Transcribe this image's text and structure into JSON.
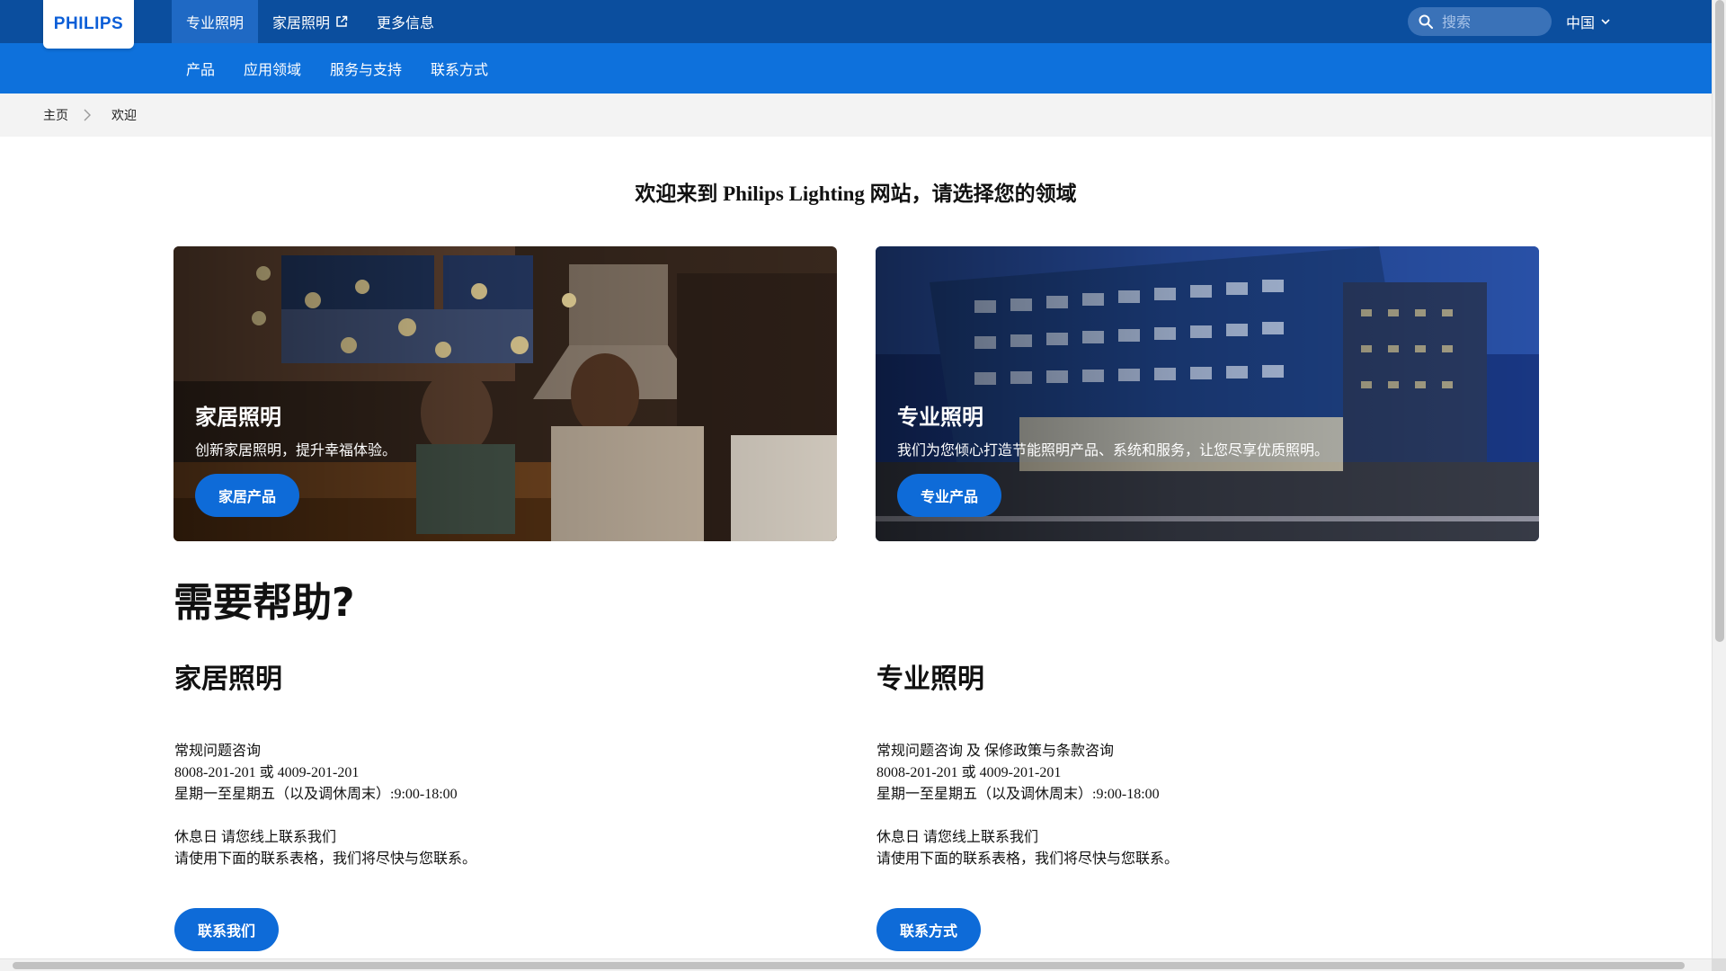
{
  "brand": {
    "logo_text": "PHILIPS",
    "accent": "#0b4e9e",
    "subnav": "#0e71dc",
    "button": "#0e6bd8"
  },
  "topnav": {
    "tabs": [
      {
        "label": "专业照明",
        "active": true
      },
      {
        "label": "家居照明",
        "icon": "external-link-icon"
      },
      {
        "label": "更多信息"
      }
    ],
    "search": {
      "placeholder": "搜索",
      "icon": "search-icon"
    },
    "region": {
      "label": "中国",
      "icon": "chevron-down-icon"
    }
  },
  "subnav": {
    "items": [
      "产品",
      "应用领域",
      "服务与支持",
      "联系方式"
    ]
  },
  "breadcrumb": {
    "items": [
      "主页",
      "欢迎"
    ]
  },
  "headline": "欢迎来到 Philips Lighting 网站，请选择您的领域",
  "cards": [
    {
      "title": "家居照明",
      "desc": "创新家居照明，提升幸福体验。",
      "button": "家居产品"
    },
    {
      "title": "专业照明",
      "desc": "我们为您倾心打造节能照明产品、系统和服务，让您尽享优质照明。",
      "button": "专业产品"
    }
  ],
  "help": {
    "title": "需要帮助?",
    "columns": [
      {
        "heading": "家居照明",
        "lines": [
          "常规问题咨询",
          "8008-201-201 或 4009-201-201",
          "星期一至星期五（以及调休周末）:9:00-18:00",
          "休息日 请您线上联系我们",
          "请使用下面的联系表格，我们将尽快与您联系。"
        ],
        "button": "联系我们"
      },
      {
        "heading": "专业照明",
        "lines": [
          "常规问题咨询 及 保修政策与条款咨询",
          "8008-201-201 或 4009-201-201",
          "星期一至星期五（以及调休周末）:9:00-18:00",
          "休息日 请您线上联系我们",
          "请使用下面的联系表格，我们将尽快与您联系。"
        ],
        "button": "联系方式"
      }
    ]
  }
}
